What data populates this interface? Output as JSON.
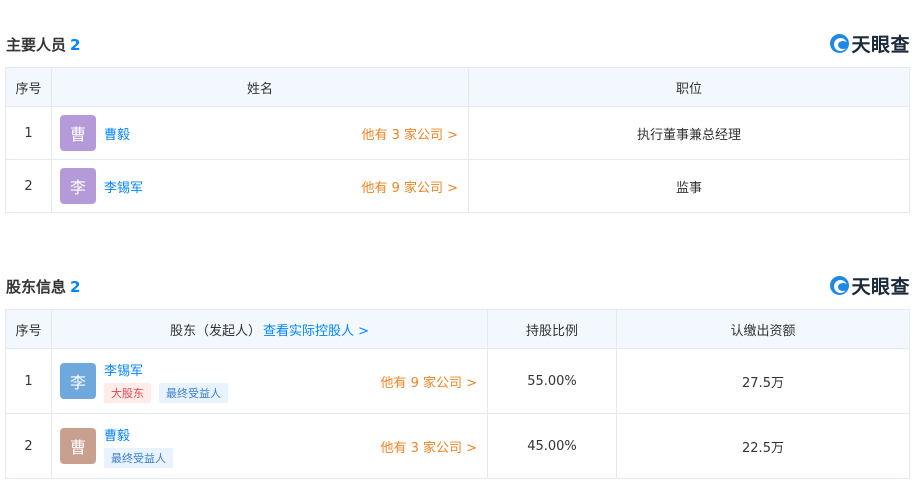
{
  "staff": {
    "title": "主要人员",
    "count": "2",
    "logo": "天眼查",
    "headers": [
      "序号",
      "姓名",
      "职位"
    ],
    "rows": [
      {
        "index": "1",
        "avatar": "曹",
        "avatar_color": "#b49ad9",
        "name": "曹毅",
        "more": "他有 3 家公司 >",
        "position": "执行董事兼总经理"
      },
      {
        "index": "2",
        "avatar": "李",
        "avatar_color": "#b49ad9",
        "name": "李锡军",
        "more": "他有 9 家公司 >",
        "position": "监事"
      }
    ]
  },
  "shareholders": {
    "title": "股东信息",
    "count": "2",
    "logo": "天眼查",
    "headers": {
      "index": "序号",
      "holder": "股东（发起人）",
      "holder_link": "查看实际控股人 >",
      "ratio": "持股比例",
      "capital": "认缴出资额"
    },
    "rows": [
      {
        "index": "1",
        "avatar": "李",
        "avatar_color": "#6fa8dc",
        "name": "李锡军",
        "tags": [
          "大股东",
          "最终受益人"
        ],
        "more": "他有 9 家公司 >",
        "ratio": "55.00%",
        "capital": "27.5万"
      },
      {
        "index": "2",
        "avatar": "曹",
        "avatar_color": "#c9a08f",
        "name": "曹毅",
        "tags": [
          "最终受益人"
        ],
        "more": "他有 3 家公司 >",
        "ratio": "45.00%",
        "capital": "22.5万"
      }
    ]
  }
}
